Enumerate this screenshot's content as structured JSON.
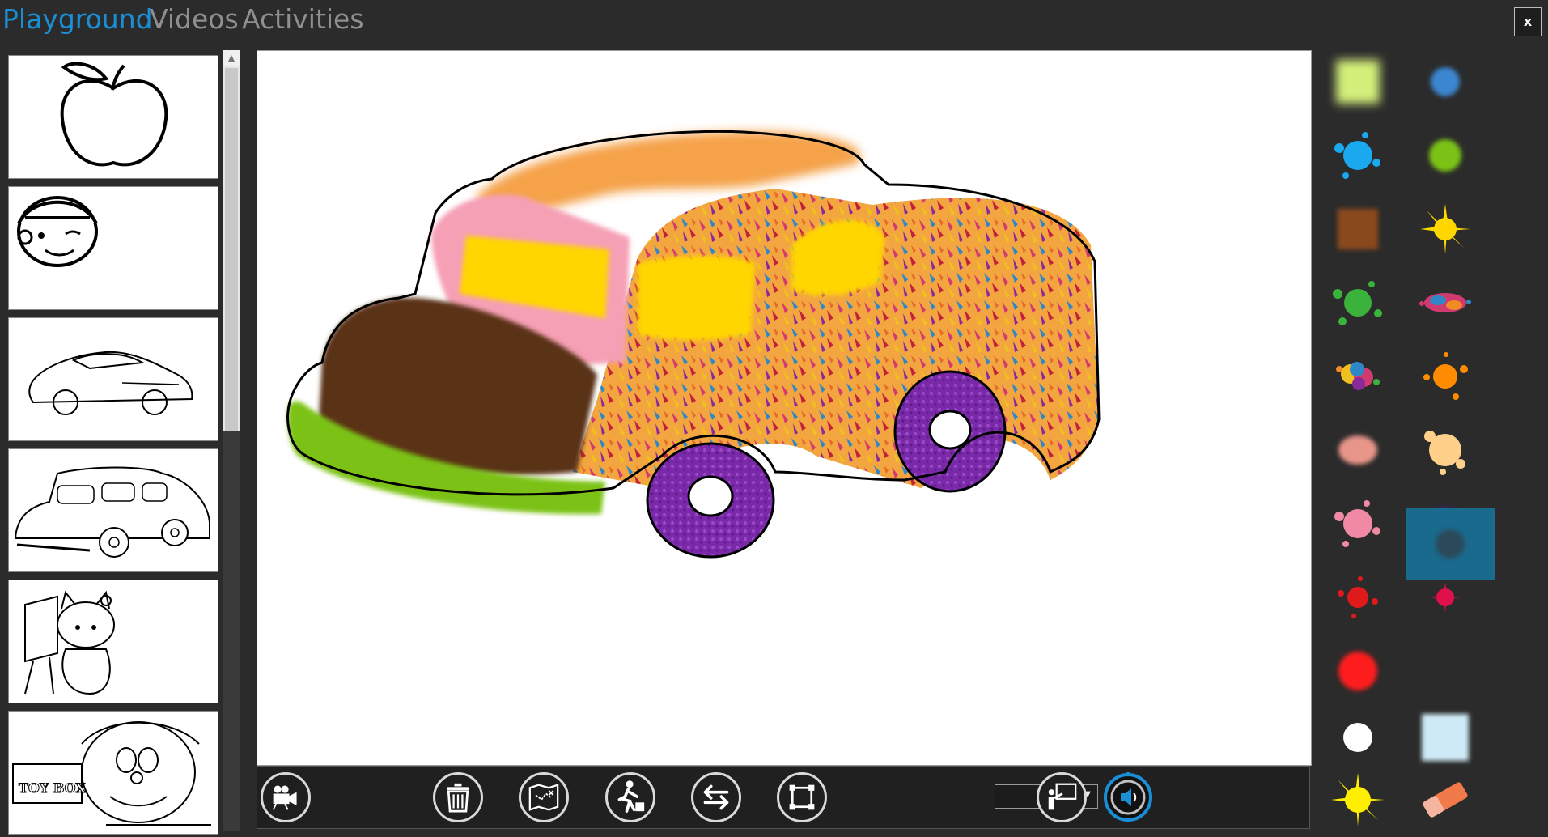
{
  "app": {
    "tabs": [
      {
        "label": "Playground",
        "active": true
      },
      {
        "label": "Videos",
        "active": false
      },
      {
        "label": "Activities",
        "active": false
      }
    ],
    "close_label": "x"
  },
  "templates": [
    {
      "name": "apple"
    },
    {
      "name": "boy-with-hat"
    },
    {
      "name": "sports-car"
    },
    {
      "name": "old-car"
    },
    {
      "name": "hello-kitty-painting"
    },
    {
      "name": "doraemon",
      "label": "TOY BOX"
    }
  ],
  "toolbar": {
    "tools": [
      {
        "name": "record-video-icon"
      },
      {
        "name": "trash-icon"
      },
      {
        "name": "map-icon"
      },
      {
        "name": "traveler-icon"
      },
      {
        "name": "swap-arrows-icon"
      },
      {
        "name": "fullscreen-icon"
      },
      {
        "name": "presentation-icon"
      }
    ],
    "brush_size_value": "",
    "volume_icon": "volume-knob-icon"
  },
  "palette": {
    "selected_index": 19,
    "brushes": [
      {
        "name": "yellow-glow-brush",
        "color": "#d4f07a"
      },
      {
        "name": "blue-glow-brush",
        "color": "#3a86d0"
      },
      {
        "name": "cyan-splat-brush",
        "color": "#1aa8ef"
      },
      {
        "name": "green-glow-brush",
        "color": "#7cc217"
      },
      {
        "name": "brown-texture-brush",
        "color": "#8a4a1e"
      },
      {
        "name": "yellow-burst-brush",
        "color": "#ffd700"
      },
      {
        "name": "green-splat-brush",
        "color": "#3bb23b"
      },
      {
        "name": "multicolor-splash-brush",
        "color": "#d03b6f"
      },
      {
        "name": "rainbow-splat-brush",
        "color": "#f08a24"
      },
      {
        "name": "orange-splat-brush",
        "color": "#ff8c00"
      },
      {
        "name": "salmon-dust-brush",
        "color": "#e8958a"
      },
      {
        "name": "peach-splat-brush",
        "color": "#ffd08a"
      },
      {
        "name": "pink-splat-brush",
        "color": "#f08aa4"
      },
      {
        "name": "purple-glow-brush",
        "color": "#4a1a8a"
      },
      {
        "name": "red-splat-brush",
        "color": "#e01a1a"
      },
      {
        "name": "magenta-burst-brush",
        "color": "#e0104a"
      },
      {
        "name": "red-circle-brush",
        "color": "#ff1a1a"
      },
      {
        "name": "dark-blur-brush",
        "color": "#2a4a5a"
      },
      {
        "name": "white-dot-brush",
        "color": "#ffffff"
      },
      {
        "name": "light-blue-glow-brush",
        "color": "#cfeaf7"
      },
      {
        "name": "yellow-star-brush",
        "color": "#ffee00"
      },
      {
        "name": "eraser-icon",
        "color": "#f07a4a"
      }
    ]
  },
  "colors": {
    "accent": "#1a8fd6",
    "background": "#2b2b2b",
    "car_roof": "#f5a24a",
    "car_window": "#ffd600",
    "car_hood": "#5a3318",
    "car_bumper": "#7cc217",
    "car_wheel": "#7a2aa8",
    "car_front_pink": "#f5a0b5"
  }
}
